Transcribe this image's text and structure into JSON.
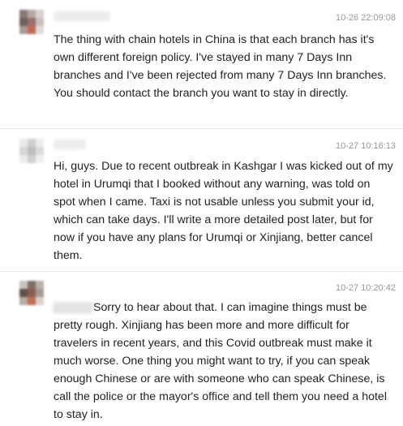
{
  "comments": [
    {
      "timestamp": "10-26 22:09:08",
      "text": "The thing with chain hotels in China is that each branch has it's own different foreign policy. I've stayed in many 7 Days Inn branches and I've been rejected from many 7 Days Inn branches. You should contact the branch you want to stay in directly."
    },
    {
      "timestamp": "10-27 10:16:13",
      "text": "Hi, guys. Due to recent outbreak in Kashgar I was kicked out of my hotel in Urumqi that I booked without any warning, was told on spot when I came. Taxi is not usable unless you submit your id, which can take days. I'll write a more detailed post later, but for now if you have any plans for Urumqi or Xinjiang, better cancel them."
    },
    {
      "timestamp": "10-27 10:20:42",
      "text": "Sorry to hear about that. I can imagine things must be pretty rough. Xinjiang has been more and more difficult for travelers in recent years, and this Covid outbreak must make it much worse. One thing you might want to try, if you can speak enough Chinese or are with someone who can speak Chinese, is call the police or the mayor's office and tell them you need a hotel to stay in."
    }
  ]
}
